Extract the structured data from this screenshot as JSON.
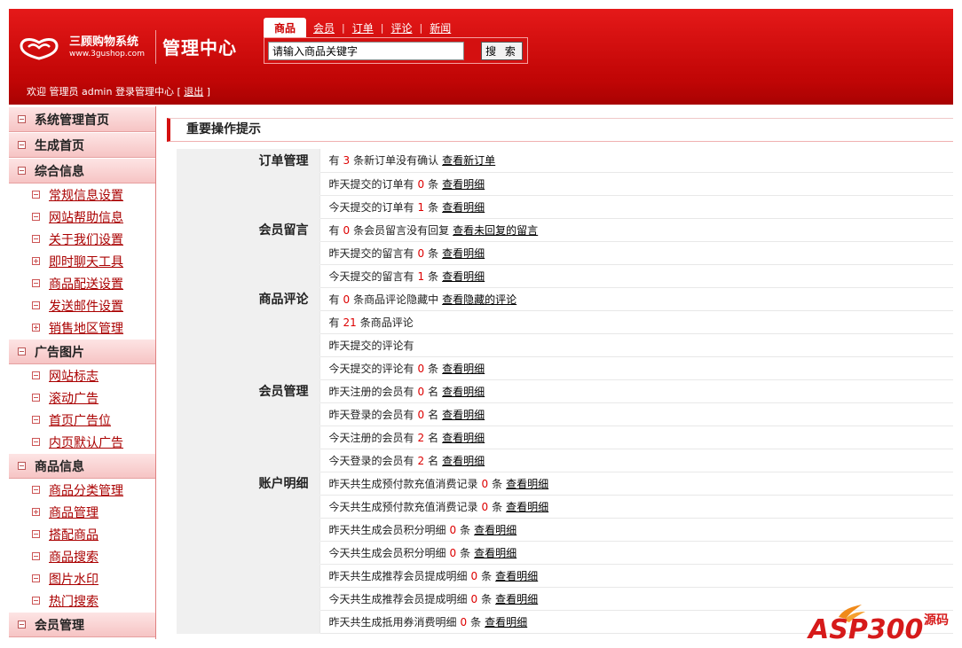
{
  "brand": {
    "name": "三顾购物系统",
    "url": "www.3gushop.com",
    "admin_title": "管理中心"
  },
  "topnav": {
    "active": "商品",
    "tabs": [
      "会员",
      "订单",
      "评论",
      "新闻"
    ]
  },
  "search": {
    "value": "请输入商品关键字",
    "button": "搜 索"
  },
  "welcome": {
    "text": "欢迎 管理员 admin 登录管理中心 [ ",
    "logout": "退出",
    "close": " ]"
  },
  "sidebar": [
    {
      "label": "系统管理首页",
      "items": []
    },
    {
      "label": "生成首页",
      "items": []
    },
    {
      "label": "综合信息",
      "items": [
        {
          "label": "常规信息设置",
          "icon": "minus"
        },
        {
          "label": "网站帮助信息",
          "icon": "minus"
        },
        {
          "label": "关于我们设置",
          "icon": "minus"
        },
        {
          "label": "即时聊天工具",
          "icon": "plus"
        },
        {
          "label": "商品配送设置",
          "icon": "minus"
        },
        {
          "label": "发送邮件设置",
          "icon": "minus"
        },
        {
          "label": "销售地区管理",
          "icon": "plus"
        }
      ]
    },
    {
      "label": "广告图片",
      "items": [
        {
          "label": "网站标志",
          "icon": "minus"
        },
        {
          "label": "滚动广告",
          "icon": "minus"
        },
        {
          "label": "首页广告位",
          "icon": "minus"
        },
        {
          "label": "内页默认广告",
          "icon": "minus"
        }
      ]
    },
    {
      "label": "商品信息",
      "items": [
        {
          "label": "商品分类管理",
          "icon": "minus"
        },
        {
          "label": "商品管理",
          "icon": "plus"
        },
        {
          "label": "搭配商品",
          "icon": "minus"
        },
        {
          "label": "商品搜索",
          "icon": "minus"
        },
        {
          "label": "图片水印",
          "icon": "minus"
        },
        {
          "label": "热门搜索",
          "icon": "minus"
        }
      ]
    },
    {
      "label": "会员管理",
      "items": []
    }
  ],
  "main": {
    "title": "重要操作提示",
    "rows": [
      {
        "cat": "订单管理",
        "pre": "有",
        "num": "3",
        "post": "条新订单没有确认",
        "link": "查看新订单"
      },
      {
        "cat": "",
        "pre": "昨天提交的订单有",
        "num": "0",
        "post": "条",
        "link": "查看明细"
      },
      {
        "cat": "",
        "pre": "今天提交的订单有",
        "num": "1",
        "post": "条",
        "link": "查看明细"
      },
      {
        "cat": "会员留言",
        "pre": "有",
        "num": "0",
        "post": "条会员留言没有回复",
        "link": "查看未回复的留言"
      },
      {
        "cat": "",
        "pre": "昨天提交的留言有",
        "num": "0",
        "post": "条",
        "link": "查看明细"
      },
      {
        "cat": "",
        "pre": "今天提交的留言有",
        "num": "1",
        "post": "条",
        "link": "查看明细"
      },
      {
        "cat": "商品评论",
        "pre": "有",
        "num": "0",
        "post": "条商品评论隐藏中",
        "link": "查看隐藏的评论"
      },
      {
        "cat": "",
        "pre": "有",
        "num": "21",
        "post": "条商品评论",
        "link": ""
      },
      {
        "cat": "",
        "pre": "昨天提交的评论有",
        "num": "",
        "post": "",
        "link": ""
      },
      {
        "cat": "",
        "pre": "今天提交的评论有",
        "num": "0",
        "post": "条",
        "link": "查看明细"
      },
      {
        "cat": "会员管理",
        "pre": "昨天注册的会员有",
        "num": "0",
        "post": "名",
        "link": "查看明细"
      },
      {
        "cat": "",
        "pre": "昨天登录的会员有",
        "num": "0",
        "post": "名",
        "link": "查看明细"
      },
      {
        "cat": "",
        "pre": "今天注册的会员有",
        "num": "2",
        "post": "名",
        "link": "查看明细"
      },
      {
        "cat": "",
        "pre": "今天登录的会员有",
        "num": "2",
        "post": "名",
        "link": "查看明细"
      },
      {
        "cat": "账户明细",
        "pre": "昨天共生成预付款充值消费记录",
        "num": "0",
        "post": "条",
        "link": "查看明细"
      },
      {
        "cat": "",
        "pre": "今天共生成预付款充值消费记录",
        "num": "0",
        "post": "条",
        "link": "查看明细"
      },
      {
        "cat": "",
        "pre": "昨天共生成会员积分明细",
        "num": "0",
        "post": "条",
        "link": "查看明细"
      },
      {
        "cat": "",
        "pre": "今天共生成会员积分明细",
        "num": "0",
        "post": "条",
        "link": "查看明细"
      },
      {
        "cat": "",
        "pre": "昨天共生成推荐会员提成明细",
        "num": "0",
        "post": "条",
        "link": "查看明细"
      },
      {
        "cat": "",
        "pre": "今天共生成推荐会员提成明细",
        "num": "0",
        "post": "条",
        "link": "查看明细"
      },
      {
        "cat": "",
        "pre": "昨天共生成抵用券消费明细",
        "num": "0",
        "post": "条",
        "link": "查看明细"
      }
    ]
  },
  "watermark": {
    "text": "ASP300",
    "suffix": "源码"
  },
  "colors": {
    "brand_red": "#d41010",
    "header_dark": "#a80202",
    "sidebar_bg": "#f6c4c4",
    "number_red": "#dd0000"
  }
}
